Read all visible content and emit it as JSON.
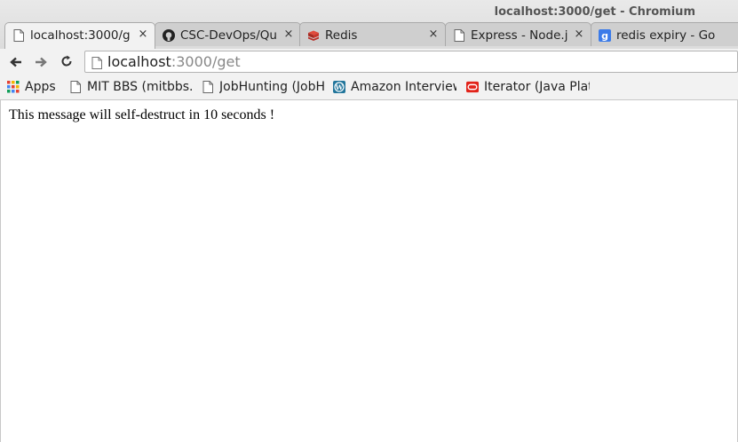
{
  "window": {
    "title": "localhost:3000/get - Chromium"
  },
  "tabs": [
    {
      "label": "localhost:3000/g",
      "icon": "page-icon",
      "close": "×",
      "active": true
    },
    {
      "label": "CSC-DevOps/Qu",
      "icon": "github-icon",
      "close": "×",
      "active": false
    },
    {
      "label": "Redis",
      "icon": "redis-icon",
      "close": "×",
      "active": false
    },
    {
      "label": "Express - Node.j",
      "icon": "page-icon",
      "close": "×",
      "active": false
    },
    {
      "label": "redis expiry - Go",
      "icon": "google-icon",
      "close": "",
      "active": false
    }
  ],
  "toolbar": {
    "url_host": "localhost",
    "url_rest": ":3000/get"
  },
  "bookmarks": [
    {
      "label": "Apps",
      "icon": "apps-grid-icon"
    },
    {
      "label": "MIT BBS (mitbbs.c",
      "icon": "page-icon"
    },
    {
      "label": "JobHunting (JobHu",
      "icon": "page-icon"
    },
    {
      "label": "Amazon Interview",
      "icon": "wordpress-icon"
    },
    {
      "label": "Iterator (Java Platf",
      "icon": "oracle-icon"
    }
  ],
  "page": {
    "message": "This message will self-destruct in 10 seconds !"
  },
  "colors": {
    "chrome_bg": "#f2f2f2",
    "tab_inactive": "#cfcfcf",
    "url_rest": "#888888"
  }
}
